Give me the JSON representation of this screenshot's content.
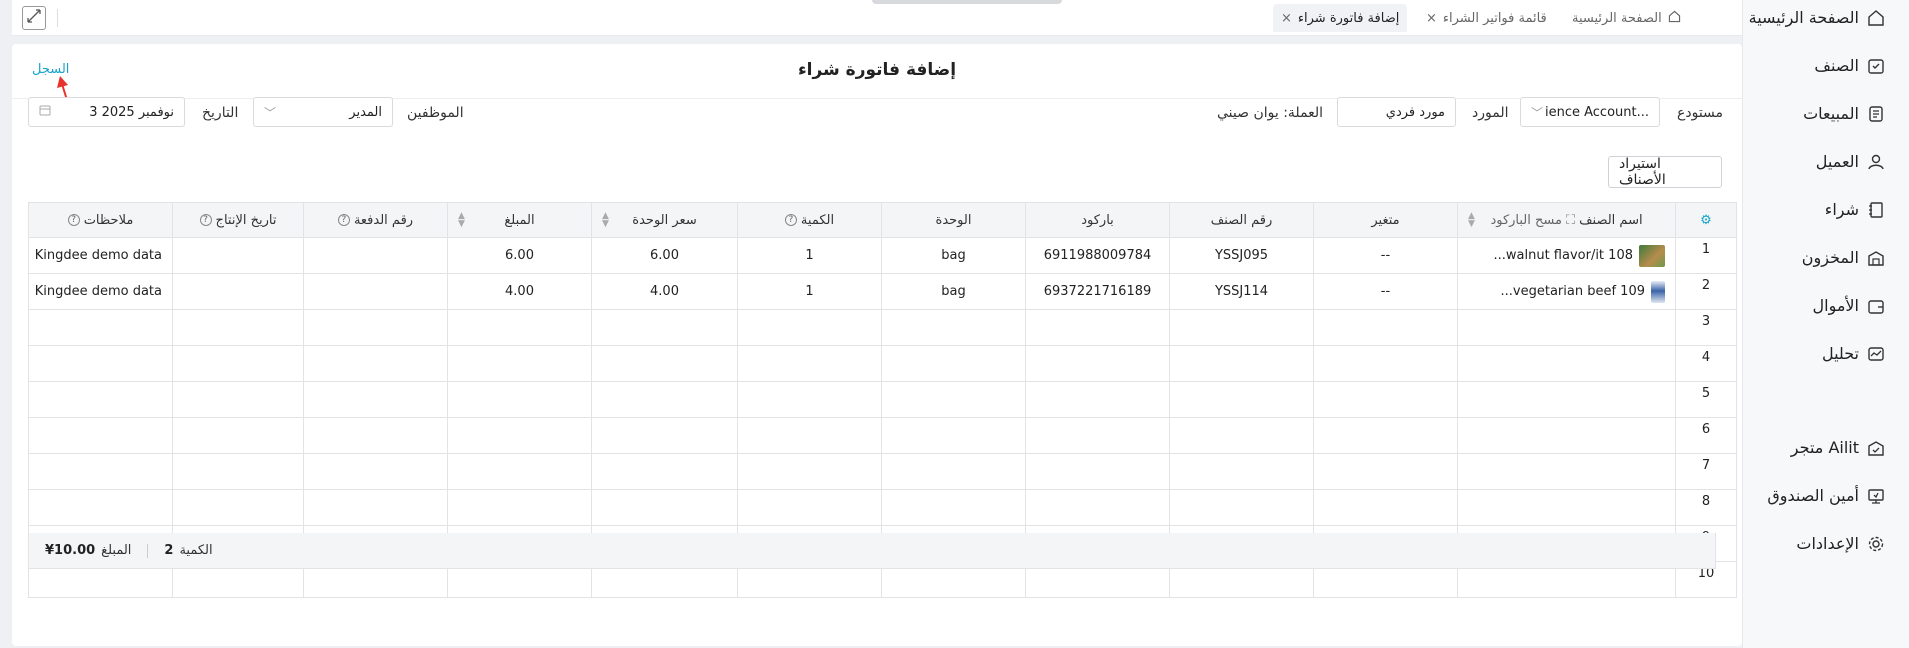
{
  "sidebar": {
    "items": [
      {
        "label": "الصفحة الرئيسية",
        "icon": "home-icon"
      },
      {
        "label": "الصنف",
        "icon": "box-icon"
      },
      {
        "label": "المبيعات",
        "icon": "sales-icon"
      },
      {
        "label": "العميل",
        "icon": "user-icon"
      },
      {
        "label": "شراء",
        "icon": "purchase-icon"
      },
      {
        "label": "المخزون",
        "icon": "warehouse-icon"
      },
      {
        "label": "الأموال",
        "icon": "wallet-icon"
      },
      {
        "label": "تحليل",
        "icon": "chart-icon"
      },
      {
        "label": "متجر Ailit",
        "icon": "store-icon"
      },
      {
        "label": "أمين الصندوق",
        "icon": "cashier-icon"
      },
      {
        "label": "الإعدادات",
        "icon": "gear-icon"
      }
    ]
  },
  "tabs": [
    {
      "label": "الصفحة الرئيسية"
    },
    {
      "label": "قائمة فواتير الشراء",
      "close": "×"
    },
    {
      "label": "إضافة فاتورة شراء",
      "close": "×"
    }
  ],
  "page": {
    "title": "إضافة فاتورة شراء",
    "history_link": "السجل"
  },
  "form": {
    "warehouse_label": "مستودع",
    "warehouse_value": "ience Account...",
    "supplier_label": "المورد",
    "supplier_value": "مورد فردي",
    "currency_text": "العملة: يوان صيني",
    "staff_label": "الموظفين",
    "staff_value": "المدير",
    "date_label": "التاريخ",
    "date_value": "3 نوفمبر 2025",
    "import_button": "استيراد الأصناف"
  },
  "table": {
    "headers": {
      "item_name": "اسم الصنف",
      "scan_barcode": "مسح الباركود",
      "variant": "متغير",
      "item_no": "رقم الصنف",
      "barcode": "باركود",
      "unit": "الوحدة",
      "qty": "الكمية",
      "unit_price": "سعر الوحدة",
      "amount": "المبلغ",
      "batch_no": "رقم الدفعة",
      "prod_date": "تاريخ الإنتاج",
      "notes": "ملاحظات"
    },
    "rows": [
      {
        "n": "1",
        "item": "108 walnut flavor/it...",
        "variant": "--",
        "item_no": "YSSJ095",
        "barcode": "6911988009784",
        "unit": "bag",
        "qty": "1",
        "price": "6.00",
        "amount": "6.00",
        "batch": "",
        "prod": "",
        "notes": "Kingdee demo data"
      },
      {
        "n": "2",
        "item": "109 vegetarian beef...",
        "variant": "--",
        "item_no": "YSSJ114",
        "barcode": "6937221716189",
        "unit": "bag",
        "qty": "1",
        "price": "4.00",
        "amount": "4.00",
        "batch": "",
        "prod": "",
        "notes": "Kingdee demo data"
      },
      {
        "n": "3"
      },
      {
        "n": "4"
      },
      {
        "n": "5"
      },
      {
        "n": "6"
      },
      {
        "n": "7"
      },
      {
        "n": "8"
      },
      {
        "n": "9"
      },
      {
        "n": "10"
      }
    ]
  },
  "footer": {
    "qty_label": "الكمية",
    "qty_value": "2",
    "amount_label": "المبلغ",
    "amount_value": "¥10.00"
  },
  "colors": {
    "accent": "#1aa3c9",
    "arrow": "#e8322b"
  }
}
